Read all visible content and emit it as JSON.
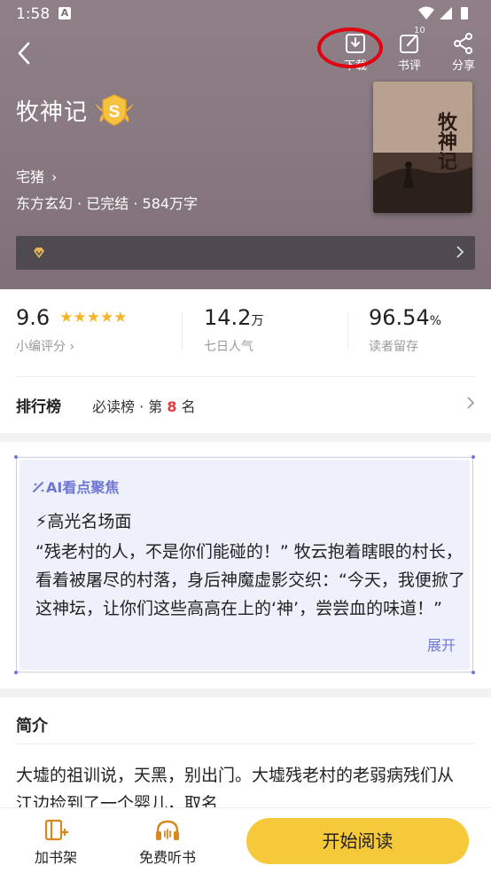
{
  "status_bar": {
    "time": "1:58",
    "notification_letter": "A"
  },
  "header_actions": {
    "download_label": "下载",
    "review_label": "书评",
    "review_count": "10",
    "share_label": "分享"
  },
  "book": {
    "title": "牧神记",
    "badge_letter": "S",
    "author": "宅猪",
    "meta": "东方玄幻 · 已完结 · 584万字",
    "cover_title": "牧神记"
  },
  "stats": {
    "rating": "9.6",
    "rating_stars": "★★★★★",
    "rating_label": "小编评分 ›",
    "popularity": "14.2",
    "popularity_unit": "万",
    "popularity_label": "七日人气",
    "retention": "96.54",
    "retention_unit": "%",
    "retention_label": "读者留存"
  },
  "ranking": {
    "title": "排行榜",
    "list_name": "必读榜",
    "prefix": "· 第",
    "rank": "8",
    "suffix": "名"
  },
  "ai_focus": {
    "title": "AI看点聚焦",
    "highlight_heading": "⚡高光名场面",
    "highlight_text": "“残老村的人，不是你们能碰的！” 牧云抱着瞎眼的村长，看着被屠尽的村落，身后神魔虚影交织：“今天，我便掀了这神坛，让你们这些高高在上的‘神’，尝尝血的味道！”",
    "expand_label": "展开"
  },
  "intro": {
    "title": "简介",
    "text": "大墟的祖训说，天黑，别出门。大墟残老村的老弱病残们从江边捡到了一个婴儿，取名"
  },
  "bottom_bar": {
    "shelf_label": "加书架",
    "listen_label": "免费听书",
    "read_label": "开始阅读"
  },
  "colors": {
    "accent_yellow": "#f6c93a",
    "ai_accent": "#6f77d6",
    "rank_red": "#e23b3b",
    "star_gold": "#f5b52a",
    "annotation_red": "#e0000f"
  }
}
